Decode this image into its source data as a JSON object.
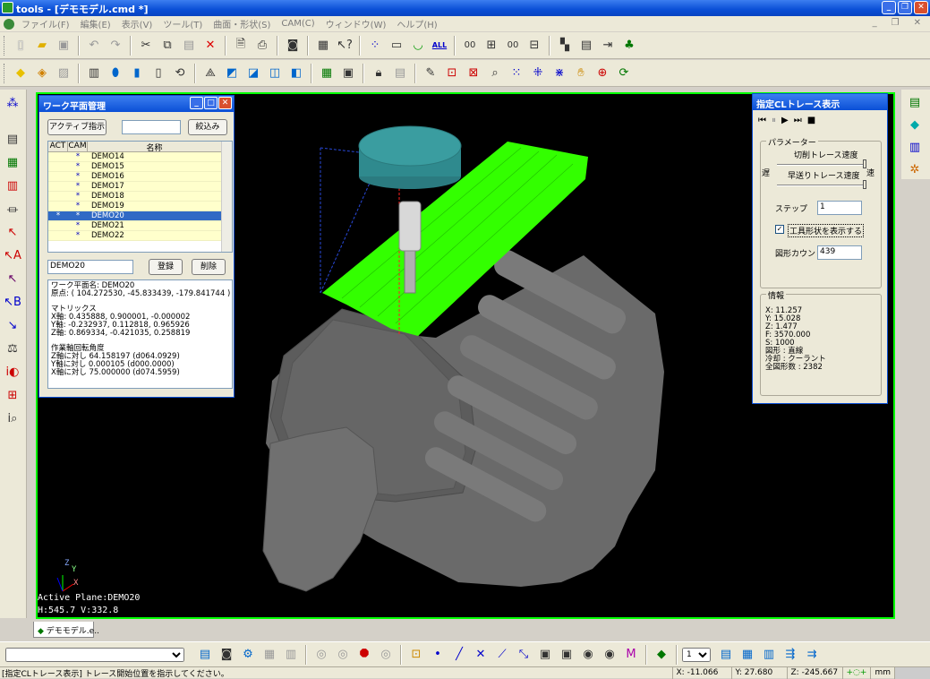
{
  "window": {
    "title": "tools - [デモモデル.cmd *]"
  },
  "menu": [
    "ファイル(F)",
    "編集(E)",
    "表示(V)",
    "ツール(T)",
    "曲面・形状(S)",
    "CAM(C)",
    "ウィンドウ(W)",
    "ヘルプ(H)"
  ],
  "toolbar2_labels": {
    "all": "ALL",
    "o1": "00",
    "o2": "00"
  },
  "work_plane_panel": {
    "title": "ワーク平面管理",
    "active_button": "アクティブ指示",
    "filter_button": "絞込み",
    "list_headers": [
      "ACT",
      "CAM",
      "名称"
    ],
    "rows": [
      {
        "act": "",
        "cam": "*",
        "name": "DEMO14",
        "selected": false
      },
      {
        "act": "",
        "cam": "*",
        "name": "DEMO15",
        "selected": false
      },
      {
        "act": "",
        "cam": "*",
        "name": "DEMO16",
        "selected": false
      },
      {
        "act": "",
        "cam": "*",
        "name": "DEMO17",
        "selected": false
      },
      {
        "act": "",
        "cam": "*",
        "name": "DEMO18",
        "selected": false
      },
      {
        "act": "",
        "cam": "*",
        "name": "DEMO19",
        "selected": false
      },
      {
        "act": "*",
        "cam": "*",
        "name": "DEMO20",
        "selected": true
      },
      {
        "act": "",
        "cam": "*",
        "name": "DEMO21",
        "selected": false
      },
      {
        "act": "",
        "cam": "*",
        "name": "DEMO22",
        "selected": false
      }
    ],
    "name_field": "DEMO20",
    "register_button": "登録",
    "delete_button": "削除",
    "info": {
      "name_line": "ワーク平面名:  DEMO20",
      "origin_line": "原点:  ( 104.272530, -45.833439, -179.841744 )",
      "matrix_title": "マトリックス",
      "x_axis": "X軸:  0.435888, 0.900001, -0.000002",
      "y_axis": "Y軸:  -0.232937, 0.112818, 0.965926",
      "z_axis": "Z軸:  0.869334, -0.421035, 0.258819",
      "rot_title": "作業軸回転角度",
      "rot_z": "Z軸に対し  64.158197 (d064.0929)",
      "rot_y": "Y軸に対し  0.000105 (d000.0000)",
      "rot_x": "X軸に対し  75.000000 (d074.5959)"
    }
  },
  "cl_trace_panel": {
    "title": "指定CLトレース表示",
    "param_group": "パラメーター",
    "cut_speed_label": "切削トレース速度",
    "rapid_speed_label": "早送りトレース速度",
    "slow_label": "遅",
    "fast_label": "速",
    "step_label": "ステップ",
    "step_value": "1",
    "show_tool_label": "工具形状を表示する",
    "show_tool_checked": true,
    "count_label": "図形カウント",
    "count_value": "439",
    "info_group": "情報",
    "info_lines": [
      "X:     11.257",
      "Y:     15.028",
      "Z:      1.477",
      "F:   3570.000",
      "S:      1000",
      "図形 : 直線",
      "冷却 : クーラント",
      "全図形数 :      2382"
    ]
  },
  "viewport": {
    "active_plane": "Active Plane:DEMO20",
    "hv": "H:545.7 V:332.8",
    "axis_x": "X",
    "axis_y": "Y",
    "axis_z": "Z"
  },
  "model_tab": "デモモデル.e..",
  "bottom_toolbar": {
    "combo_value": "",
    "layer_value": "1"
  },
  "statusbar": {
    "message": "[指定CLトレース表示] トレース開始位置を指示してください。",
    "x_label": "X:",
    "x_value": "-11.066",
    "y_label": "Y:",
    "y_value": "27.680",
    "z_label": "Z:",
    "z_value": "-245.667",
    "unit": "mm"
  },
  "colors": {
    "titlebar": "#0a4fd6",
    "viewport_border": "#00ff00",
    "toolpath": "#33ff00",
    "model": "#6e6e6e",
    "tool_holder": "#2f8a8e"
  }
}
